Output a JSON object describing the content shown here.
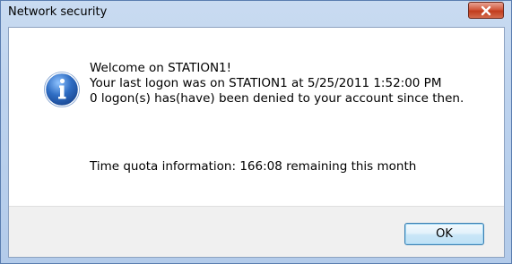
{
  "window": {
    "title": "Network security",
    "close_icon": "close-x-icon"
  },
  "message": {
    "icon": "information-icon",
    "lines": [
      "Welcome on STATION1!",
      "Your last logon was on STATION1 at 5/25/2011 1:52:00 PM",
      "0 logon(s) has(have) been denied to your account since then."
    ],
    "quota": "Time quota information: 166:08 remaining this month"
  },
  "buttons": {
    "ok_label": "OK"
  },
  "colors": {
    "title_bar": "#bcd2ee",
    "close_button": "#c74a2c",
    "info_icon": "#2f6dc3",
    "ok_button_border": "#3c7fb1"
  }
}
